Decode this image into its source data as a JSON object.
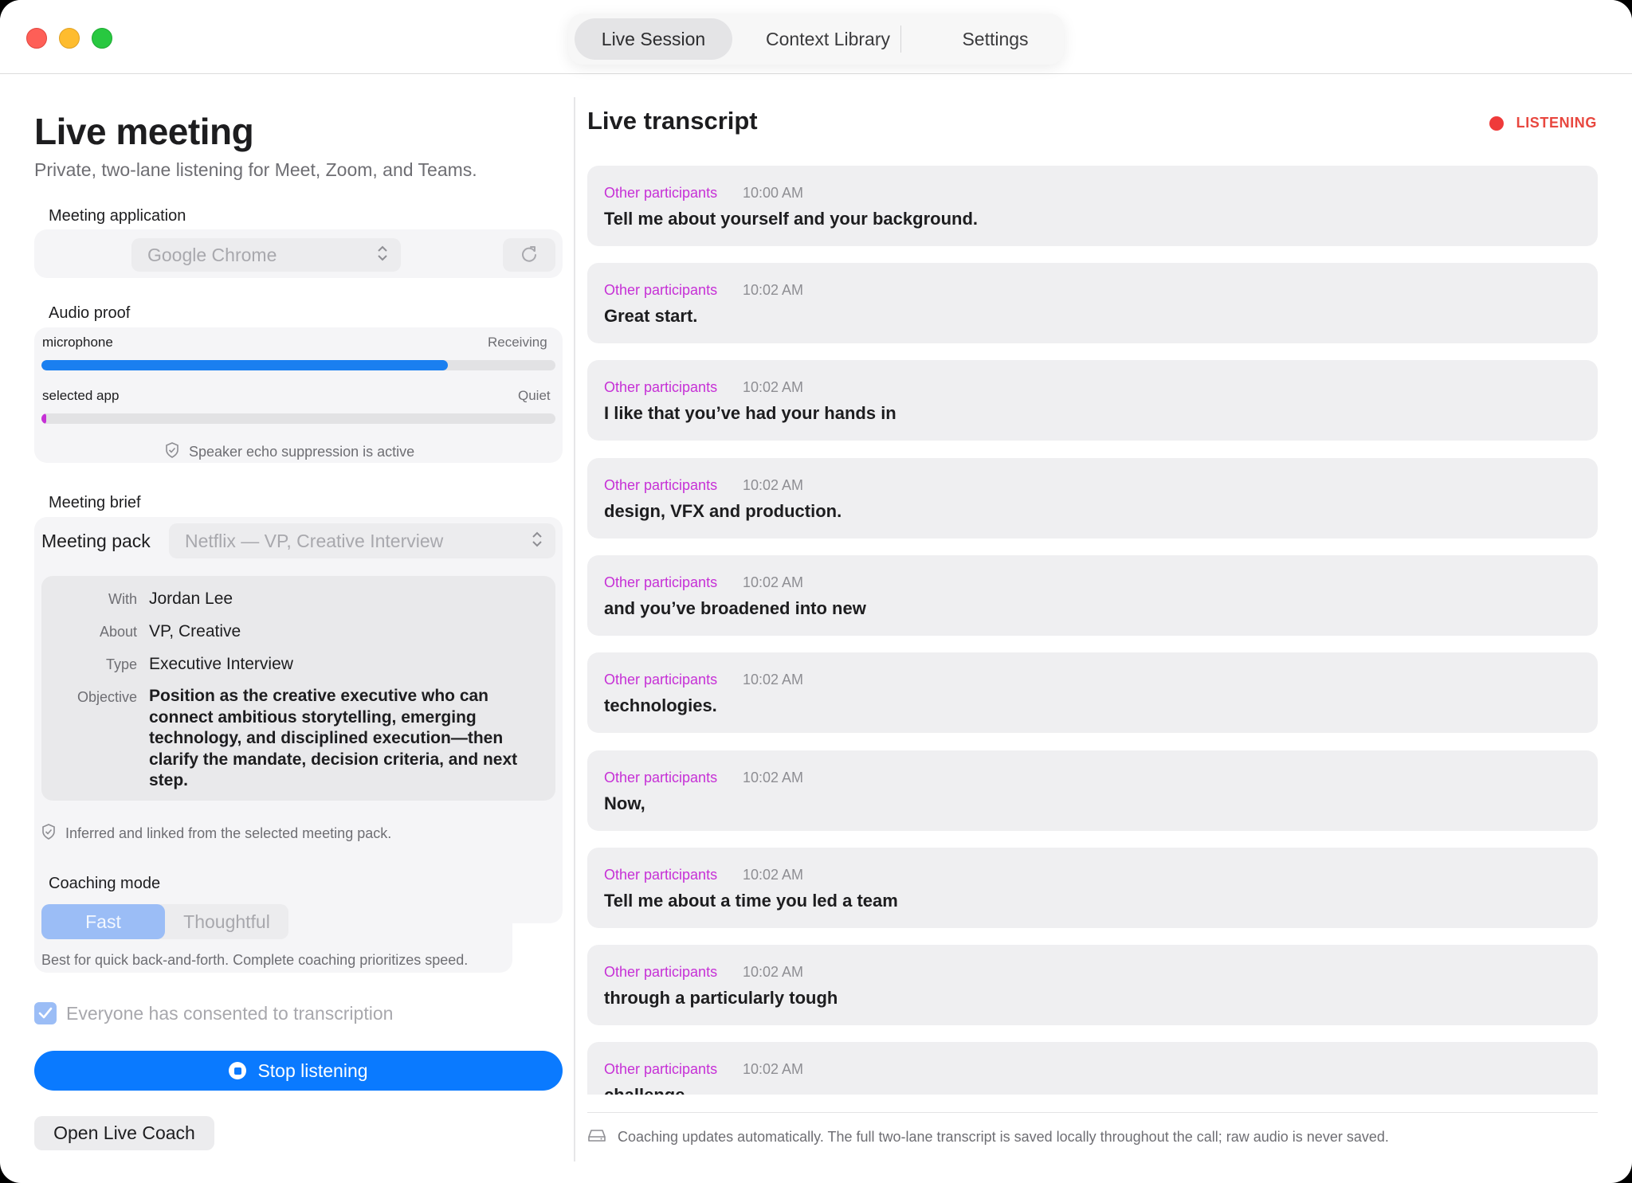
{
  "tabs": {
    "live_session": "Live Session",
    "context_library": "Context Library",
    "settings": "Settings"
  },
  "left": {
    "title": "Live meeting",
    "subtitle": "Private, two-lane listening for Meet, Zoom, and Teams.",
    "meeting_app": {
      "label": "Meeting application",
      "selected": "Google Chrome"
    },
    "audio_proof": {
      "label": "Audio proof",
      "mic_label": "microphone",
      "mic_status": "Receiving",
      "mic_level": 0.79,
      "app_label": "selected app",
      "app_status": "Quiet",
      "app_level": 0.01,
      "echo_note": "Speaker echo suppression is active"
    },
    "brief": {
      "label": "Meeting brief",
      "pack_label": "Meeting pack",
      "pack_selected": "Netflix — VP, Creative Interview",
      "with_key": "With",
      "with_val": "Jordan Lee",
      "about_key": "About",
      "about_val": "VP, Creative",
      "type_key": "Type",
      "type_val": "Executive Interview",
      "objective_key": "Objective",
      "objective_val": "Position as the creative executive who can connect ambitious storytelling, emerging technology, and disciplined execution—then clarify the mandate, decision criteria, and next step.",
      "inferred_note": "Inferred and linked from the selected meeting pack."
    },
    "coaching": {
      "label": "Coaching mode",
      "fast": "Fast",
      "thoughtful": "Thoughtful",
      "hint": "Best for quick back-and-forth. Complete coaching prioritizes speed."
    },
    "consent_label": "Everyone has consented to transcription",
    "stop_label": "Stop listening",
    "open_coach_label": "Open Live Coach"
  },
  "right": {
    "title": "Live transcript",
    "status": "LISTENING",
    "messages": [
      {
        "who": "Other participants",
        "time": "10:00 AM",
        "text": "Tell me about yourself and your background."
      },
      {
        "who": "Other participants",
        "time": "10:02 AM",
        "text": "Great start."
      },
      {
        "who": "Other participants",
        "time": "10:02 AM",
        "text": "I like that you’ve had your hands in"
      },
      {
        "who": "Other participants",
        "time": "10:02 AM",
        "text": "design, VFX and production."
      },
      {
        "who": "Other participants",
        "time": "10:02 AM",
        "text": "and you’ve broadened into new"
      },
      {
        "who": "Other participants",
        "time": "10:02 AM",
        "text": "technologies."
      },
      {
        "who": "Other participants",
        "time": "10:02 AM",
        "text": "Now,"
      },
      {
        "who": "Other participants",
        "time": "10:02 AM",
        "text": "Tell me about a time you led a team"
      },
      {
        "who": "Other participants",
        "time": "10:02 AM",
        "text": "through a particularly tough"
      },
      {
        "who": "Other participants",
        "time": "10:02 AM",
        "text": "challenge"
      }
    ],
    "footer": "Coaching updates automatically. The full two-lane transcript is saved locally throughout the call; raw audio is never saved."
  },
  "colors": {
    "accent": "#0a7aff",
    "speaker": "#c630d6",
    "listening": "#e8473f",
    "app_meter": "#c630d6"
  }
}
